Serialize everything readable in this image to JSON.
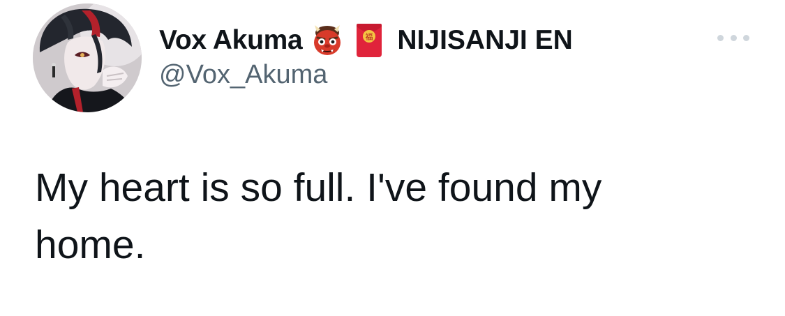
{
  "tweet": {
    "author": {
      "display_name": "Vox Akuma",
      "name_emoji_1": "japanese-ogre",
      "name_emoji_2": "red-envelope",
      "affiliation": "NIJISANJI EN",
      "handle": "@Vox_Akuma"
    },
    "more_icon": "ellipsis-icon",
    "text": "My heart is so full. I've found my\nhome."
  },
  "colors": {
    "text_primary": "#0f1419",
    "text_secondary": "#536471",
    "ogre_red": "#d83a2a",
    "envelope_red": "#e0243b",
    "background": "#ffffff"
  }
}
